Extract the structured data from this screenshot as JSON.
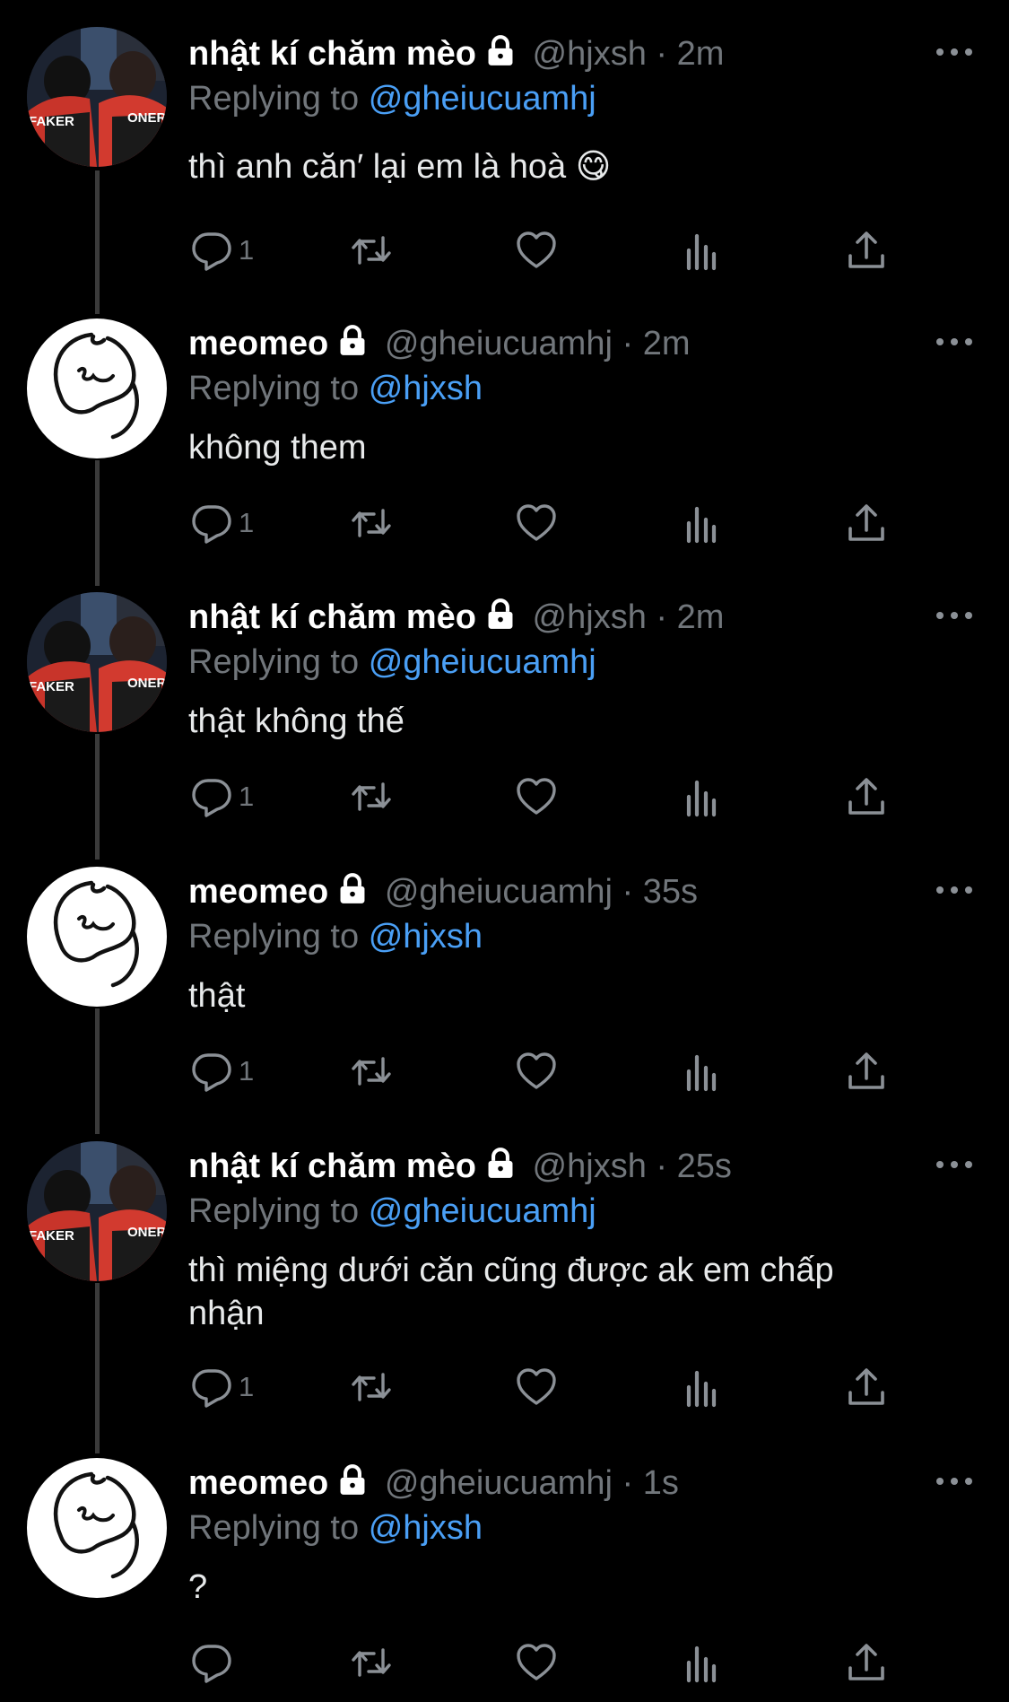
{
  "colors": {
    "background": "#000000",
    "name": "#ffffff",
    "muted": "#71767b",
    "mention": "#4a9ff5",
    "thread_line": "#3a3a3a"
  },
  "icons": {
    "avatar_photo": "avatar-photo-icon",
    "avatar_drawing": "avatar-drawing-icon",
    "lock": "lock-icon",
    "more": "more-icon",
    "reply": "reply-icon",
    "retweet": "retweet-icon",
    "like": "heart-icon",
    "views": "views-icon",
    "share": "share-icon"
  },
  "tweets": [
    {
      "name": "nhật kí chăm mèo",
      "handle": "@hjxsh",
      "separator": "·",
      "time": "2m",
      "reply_prefix": "Replying to",
      "reply_to": "@gheiucuamhj",
      "text": "thì anh căn′ lại em là hoà 😋",
      "reply_count": "1",
      "avatar": {
        "jersey_left": "FAKER",
        "jersey_right": "ONER"
      }
    },
    {
      "name": "meomeo",
      "handle": "@gheiucuamhj",
      "separator": "·",
      "time": "2m",
      "reply_prefix": "Replying to",
      "reply_to": "@hjxsh",
      "text": "không them",
      "reply_count": "1"
    },
    {
      "name": "nhật kí chăm mèo",
      "handle": "@hjxsh",
      "separator": "·",
      "time": "2m",
      "reply_prefix": "Replying to",
      "reply_to": "@gheiucuamhj",
      "text": "thật không thế",
      "reply_count": "1",
      "avatar": {
        "jersey_left": "FAKER",
        "jersey_right": "ONER"
      }
    },
    {
      "name": "meomeo",
      "handle": "@gheiucuamhj",
      "separator": "·",
      "time": "35s",
      "reply_prefix": "Replying to",
      "reply_to": "@hjxsh",
      "text": "thật",
      "reply_count": "1"
    },
    {
      "name": "nhật kí chăm mèo",
      "handle": "@hjxsh",
      "separator": "·",
      "time": "25s",
      "reply_prefix": "Replying to",
      "reply_to": "@gheiucuamhj",
      "text": "thì miệng dưới căn cũng được ak em chấp nhận",
      "reply_count": "1",
      "avatar": {
        "jersey_left": "FAKER",
        "jersey_right": "ONER"
      }
    },
    {
      "name": "meomeo",
      "handle": "@gheiucuamhj",
      "separator": "·",
      "time": "1s",
      "reply_prefix": "Replying to",
      "reply_to": "@hjxsh",
      "text": "?",
      "reply_count": ""
    }
  ]
}
